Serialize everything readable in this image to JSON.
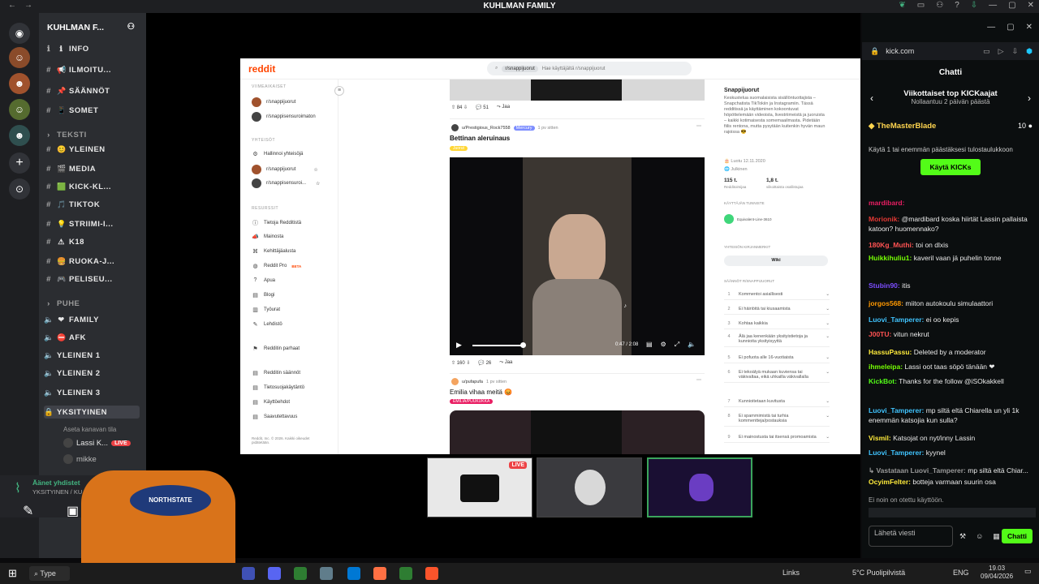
{
  "window": {
    "title": "KUHLMAN FAMILY"
  },
  "server": {
    "name": "KUHLMAN F..."
  },
  "channels": [
    {
      "icon": "info-icon",
      "emoji": "ℹ",
      "label": "INFO",
      "type": "text"
    },
    {
      "icon": "hash-icon",
      "emoji": "📢",
      "label": "ILMOITU...",
      "type": "text"
    },
    {
      "icon": "hash-icon",
      "emoji": "📌",
      "label": "SÄÄNNÖT",
      "type": "text"
    },
    {
      "icon": "hash-icon",
      "emoji": "📱",
      "label": "SOMET",
      "type": "text"
    },
    {
      "icon": "category",
      "label": "TEKSTI",
      "type": "category"
    },
    {
      "icon": "hash-icon",
      "emoji": "😊",
      "label": "YLEINEN",
      "type": "text"
    },
    {
      "icon": "hash-icon",
      "emoji": "🎬",
      "label": "MEDIA",
      "type": "text"
    },
    {
      "icon": "hash-icon",
      "emoji": "🟩",
      "label": "KICK-KL...",
      "type": "text"
    },
    {
      "icon": "hash-icon",
      "emoji": "🎵",
      "label": "TIKTOK",
      "type": "text"
    },
    {
      "icon": "hash-icon",
      "emoji": "💡",
      "label": "STRIIMI-I...",
      "type": "text"
    },
    {
      "icon": "hash-icon",
      "emoji": "⚠",
      "label": "K18",
      "type": "text"
    },
    {
      "icon": "hash-icon",
      "emoji": "🍔",
      "label": "RUOKA-J...",
      "type": "text"
    },
    {
      "icon": "hash-icon",
      "emoji": "🎮",
      "label": "PELISEU...",
      "type": "text"
    },
    {
      "icon": "category",
      "label": "PUHE",
      "type": "category"
    },
    {
      "icon": "speaker-icon",
      "emoji": "❤",
      "label": "FAMILY",
      "type": "voice"
    },
    {
      "icon": "speaker-icon",
      "emoji": "⛔",
      "label": "AFK",
      "type": "voice"
    },
    {
      "icon": "speaker-icon",
      "label": "YLEINEN 1",
      "type": "voice"
    },
    {
      "icon": "speaker-icon",
      "label": "YLEINEN 2",
      "type": "voice"
    },
    {
      "icon": "speaker-icon",
      "label": "YLEINEN 3",
      "type": "voice"
    },
    {
      "icon": "lock-icon",
      "label": "YKSITYINEN",
      "type": "voice",
      "selected": true
    }
  ],
  "voice_sub": {
    "status": "Aseta kanavan tila",
    "users": [
      {
        "name": "Lassi K...",
        "live": "LIVE"
      },
      {
        "name": "mikke"
      }
    ]
  },
  "voice_conn": {
    "line1": "Äänet yhdistet",
    "line2": "YKSITYINEN / KU..."
  },
  "reddit": {
    "logo": "reddit",
    "search_chip": "r/snappijuorut",
    "search_placeholder": "Hae käyttäjältä r/snappijuorut",
    "side": {
      "h1": "VIIMEAIKAISET",
      "recent": [
        "r/snappijuorut",
        "r/snappisensuroimaton"
      ],
      "h2": "YHTEISÖT",
      "communities": [
        "Hallinnoi yhteisöjä",
        "r/snappijuorut",
        "r/snappisensuroi..."
      ],
      "h3": "RESURSSIT",
      "resources": [
        "Tietoja Redditistä",
        "Mainosta",
        "Kehittäjäalusta",
        "Reddit Pro",
        "Apua",
        "Blogi",
        "Työurat",
        "Lehdistö"
      ],
      "pro_badge": "BETA",
      "best": "Redditin parhaat",
      "legal": [
        "Redditin säännöt",
        "Tietosuojakäytäntö",
        "Käyttöehdot",
        "Saavutettavuus"
      ],
      "footer": "Reddit, Inc. © 2026. Kaikki oikeudet pidätetään."
    },
    "post1": {
      "up": "84",
      "comments": "51",
      "share": "Jaa"
    },
    "post2": {
      "user": "u/Prestigious_Rock7558",
      "flair": "Mercury",
      "time": "1 pv sitten",
      "title": "Bettinan aleruinaus",
      "tag": "Juorut",
      "time_code": "0:47 / 2:08",
      "up": "160",
      "comments": "26",
      "share": "Jaa"
    },
    "post3": {
      "user": "u/pufapufa",
      "time": "1 pv sitten",
      "title": "Emilia vihaa meitä 😡",
      "tag": "EMILIA/PUUKUKKA"
    },
    "about": {
      "title": "Snappijuorut",
      "desc": "Keskustelua suomalaisista sisällöntuottajista – Snapchatista TikTokiin ja Instagramiin. Tässä redditissä ja käyttäminen kokoontuvat höpöttelemään videoista, livestriimeistä ja juoruista – kaikki kotimaisesta somemaailmasta. Pidetään fiilis rentona, mutta pysytään kuitenkin hyvän maun rajoissa 😎",
      "created": "Luotu 12.11.2020",
      "visibility": "Julkinen",
      "members": "115 t.",
      "members_label": "Redditoimijaa",
      "online": "1,8 t.",
      "online_label": "viikoittaista osallistujaa",
      "flair_h": "KÄYTTÄJÄN TUNNISTE",
      "flair_user": "Equivalent-Line-3610",
      "bookmarks_h": "YHTEISÖN KIRJANMERKIT",
      "wiki": "Wiki",
      "rules_h": "SÄÄNNÖT R/SNAPPIJUORUT",
      "rules": [
        "Kommentoi asiallisesti",
        "Ei häiriöitä tai kiusaamista",
        "Kohtaa kaikkia",
        "Älä jaa kenenkään yksityistietoja ja kunnioita yksityisyyttä",
        "Ei pofuota alle 16-vuotiaista",
        "Ei tekoälyä mukaan kuviensa tai väkivaltaa, eikä uhkailla väkivallalla",
        "Kunnioitetaan kuvitusta",
        "Ei spammimistä tai turhia kommentteja/postauksia",
        "Ei mainostusta tai itsensä promoamista"
      ]
    }
  },
  "stream_thumbs": [
    {
      "live": "LIVE"
    },
    {},
    {}
  ],
  "kick": {
    "url": "kick.com",
    "chat_title": "Chatti",
    "top_title": "Viikottaiset top KICKaajat",
    "top_sub": "Nollaantuu 2 päivän päästä",
    "top_user": "TheMasterBlade",
    "top_amount": "10",
    "use_text": "Käytä 1  tai enemmän päästäksesi tulostaulukkoon",
    "use_btn": "Käytä KICKs",
    "messages": [
      {
        "user": "mardibard:",
        "text": "",
        "color": "#e91e63"
      },
      {
        "user": "Morionik:",
        "text": "@mardibard koska hiirtät Lassin pallaista katoon? huomennako?",
        "color": "#e53935"
      },
      {
        "user": "180Kg_Muthi:",
        "text": "toi on dlxis",
        "color": "#ff5252"
      },
      {
        "user": "Huikkihuliu1:",
        "text": "kaveril vaan jä puhelin tonne",
        "color": "#76ff03"
      },
      {
        "user": "Stubin90:",
        "text": "itis",
        "color": "#7c4dff"
      },
      {
        "user": "jorgos568:",
        "text": "miiton autokoulu simulaattori",
        "color": "#ff9800"
      },
      {
        "user": "Luovi_Tamperer:",
        "text": "ei oo kepis",
        "color": "#40c4ff"
      },
      {
        "user": "J00TU:",
        "text": "vitun nekrut",
        "color": "#ff5252"
      },
      {
        "user": "HassuPassu:",
        "text": "Deleted by a moderator",
        "color": "#ffeb3b"
      },
      {
        "user": "ihmeleipa:",
        "text": "Lassi oot taas söpö tänään ❤",
        "color": "#76ff03"
      },
      {
        "user": "KickBot:",
        "text": "Thanks for the follow @iSOkakkell",
        "color": "#53fc18"
      },
      {
        "user": "Luovi_Tamperer:",
        "text": "mp siltä eltä Chiarella un yli 1k enemmän katsojia kun sulla?",
        "color": "#40c4ff"
      },
      {
        "user": "Vismil:",
        "text": "Katsojat on nyt/inny Lassin",
        "color": "#ffeb3b"
      },
      {
        "user": "Luovi_Tamperer:",
        "text": "kyynel",
        "color": "#40c4ff"
      },
      {
        "user": "↳ Vastataan Luovi_Tamperer:",
        "text": "mp siltä eltä Chiar...",
        "color": "#999999"
      },
      {
        "user": "OcyimFelter:",
        "text": "botteja varmaan suurin osa",
        "color": "#ffeb3b"
      }
    ],
    "emote_note": "Ei noin on otettu käyttöön.",
    "send_placeholder": "Lähetä viesti",
    "send_btn": "Chatti"
  },
  "taskbar": {
    "search": "Type",
    "links": "Links",
    "weather": "5°C Puolipilvistä",
    "lang": "ENG",
    "time": "19.03",
    "date": "09/04/2026"
  }
}
